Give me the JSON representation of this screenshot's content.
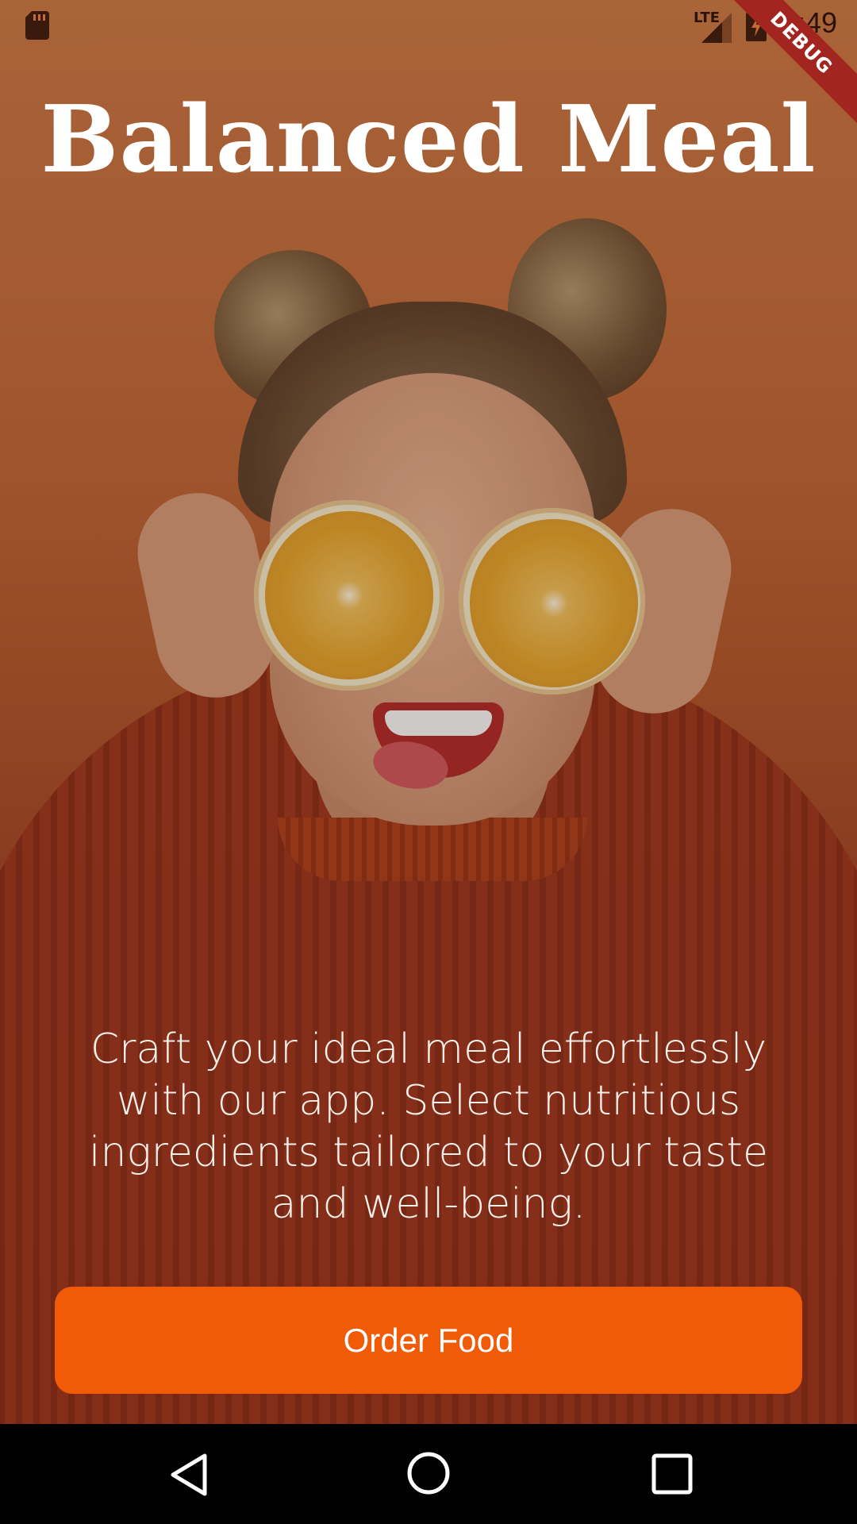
{
  "status_bar": {
    "network_label": "LTE",
    "time": "5:49",
    "debug_label": "DEBUG",
    "icons": [
      "sd-card-icon",
      "signal-icon",
      "battery-charging-icon"
    ]
  },
  "hero": {
    "title": "Balanced Meal",
    "tagline": "Craft your ideal meal effortlessly with our app. Select nutritious ingredients tailored to your taste and well-being."
  },
  "actions": {
    "order_label": "Order Food"
  },
  "nav_bar": {
    "icons": [
      "back-icon",
      "home-icon",
      "recents-icon"
    ]
  },
  "colors": {
    "accent": "#f15a06",
    "debug_ribbon": "#a3251f",
    "nav_background": "#000000"
  }
}
